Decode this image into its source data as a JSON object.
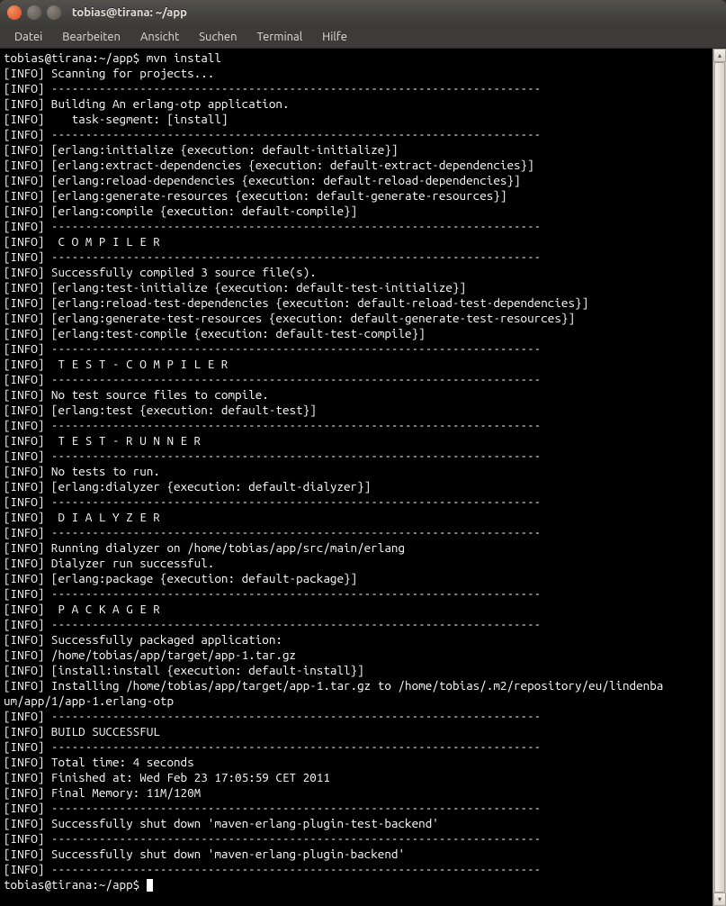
{
  "window": {
    "title": "tobias@tirana: ~/app"
  },
  "menu": {
    "datei": "Datei",
    "bearbeiten": "Bearbeiten",
    "ansicht": "Ansicht",
    "suchen": "Suchen",
    "terminal": "Terminal",
    "hilfe": "Hilfe"
  },
  "terminal": {
    "prompt1": "tobias@tirana:~/app$ ",
    "command": "mvn install",
    "prompt2": "tobias@tirana:~/app$ ",
    "lines": [
      "[INFO] Scanning for projects...",
      "[INFO] ------------------------------------------------------------------------",
      "[INFO] Building An erlang-otp application.",
      "[INFO]    task-segment: [install]",
      "[INFO] ------------------------------------------------------------------------",
      "[INFO] [erlang:initialize {execution: default-initialize}]",
      "[INFO] [erlang:extract-dependencies {execution: default-extract-dependencies}]",
      "[INFO] [erlang:reload-dependencies {execution: default-reload-dependencies}]",
      "[INFO] [erlang:generate-resources {execution: default-generate-resources}]",
      "[INFO] [erlang:compile {execution: default-compile}]",
      "[INFO] ------------------------------------------------------------------------",
      "[INFO]  C O M P I L E R",
      "[INFO] ------------------------------------------------------------------------",
      "[INFO] Successfully compiled 3 source file(s).",
      "[INFO] [erlang:test-initialize {execution: default-test-initialize}]",
      "[INFO] [erlang:reload-test-dependencies {execution: default-reload-test-dependencies}]",
      "[INFO] [erlang:generate-test-resources {execution: default-generate-test-resources}]",
      "[INFO] [erlang:test-compile {execution: default-test-compile}]",
      "[INFO] ------------------------------------------------------------------------",
      "[INFO]  T E S T - C O M P I L E R",
      "[INFO] ------------------------------------------------------------------------",
      "[INFO] No test source files to compile.",
      "[INFO] [erlang:test {execution: default-test}]",
      "[INFO] ------------------------------------------------------------------------",
      "[INFO]  T E S T - R U N N E R",
      "[INFO] ------------------------------------------------------------------------",
      "[INFO] No tests to run.",
      "[INFO] [erlang:dialyzer {execution: default-dialyzer}]",
      "[INFO] ------------------------------------------------------------------------",
      "[INFO]  D I A L Y Z E R",
      "[INFO] ------------------------------------------------------------------------",
      "[INFO] Running dialyzer on /home/tobias/app/src/main/erlang",
      "[INFO] Dialyzer run successful.",
      "[INFO] [erlang:package {execution: default-package}]",
      "[INFO] ------------------------------------------------------------------------",
      "[INFO]  P A C K A G E R",
      "[INFO] ------------------------------------------------------------------------",
      "[INFO] Successfully packaged application:",
      "[INFO] /home/tobias/app/target/app-1.tar.gz",
      "[INFO] [install:install {execution: default-install}]",
      "[INFO] Installing /home/tobias/app/target/app-1.tar.gz to /home/tobias/.m2/repository/eu/lindenba",
      "um/app/1/app-1.erlang-otp",
      "[INFO] ------------------------------------------------------------------------",
      "[INFO] BUILD SUCCESSFUL",
      "[INFO] ------------------------------------------------------------------------",
      "[INFO] Total time: 4 seconds",
      "[INFO] Finished at: Wed Feb 23 17:05:59 CET 2011",
      "[INFO] Final Memory: 11M/120M",
      "[INFO] ------------------------------------------------------------------------",
      "[INFO] Successfully shut down 'maven-erlang-plugin-test-backend'",
      "[INFO] ------------------------------------------------------------------------",
      "[INFO] Successfully shut down 'maven-erlang-plugin-backend'",
      "[INFO] ------------------------------------------------------------------------"
    ]
  }
}
